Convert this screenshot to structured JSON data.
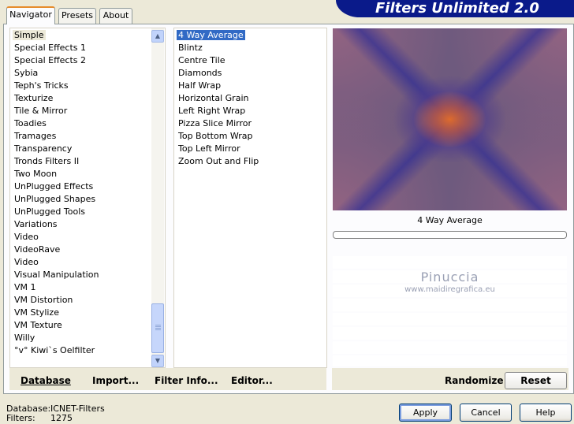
{
  "banner": {
    "title": "Filters Unlimited 2.0"
  },
  "tabs": [
    {
      "label": "Navigator"
    },
    {
      "label": "Presets"
    },
    {
      "label": "About"
    }
  ],
  "categories": [
    "Simple",
    "Special Effects 1",
    "Special Effects 2",
    "Sybia",
    "Teph's Tricks",
    "Texturize",
    "Tile & Mirror",
    "Toadies",
    "Tramages",
    "Transparency",
    "Tronds Filters II",
    "Two Moon",
    "UnPlugged Effects",
    "UnPlugged Shapes",
    "UnPlugged Tools",
    "Variations",
    "Video",
    "VideoRave",
    "Video",
    "Visual Manipulation",
    "VM 1",
    "VM Distortion",
    "VM Stylize",
    "VM Texture",
    "Willy",
    "°v° Kiwi`s Oelfilter"
  ],
  "categories_selected": "Simple",
  "filters": [
    "4 Way Average",
    "Blintz",
    "Centre Tile",
    "Diamonds",
    "Half Wrap",
    "Horizontal Grain",
    "Left Right Wrap",
    "Pizza Slice Mirror",
    "Top Bottom Wrap",
    "Top Left Mirror",
    "Zoom Out and Flip"
  ],
  "filters_selected": "4 Way Average",
  "preview": {
    "caption": "4 Way Average",
    "watermark_title": "Pinuccia",
    "watermark_url": "www.maidiregrafica.eu"
  },
  "toolbar": {
    "database": "Database",
    "import": "Import...",
    "filter_info": "Filter Info...",
    "editor": "Editor...",
    "randomize": "Randomize",
    "reset": "Reset"
  },
  "status": {
    "database_label": "Database:",
    "database_value": "ICNET-Filters",
    "filters_label": "Filters:",
    "filters_value": "1275"
  },
  "buttons": {
    "apply": "Apply",
    "cancel": "Cancel",
    "help": "Help"
  },
  "icons": {
    "scroll_up": "chevron-up-icon",
    "scroll_down": "chevron-down-icon"
  }
}
